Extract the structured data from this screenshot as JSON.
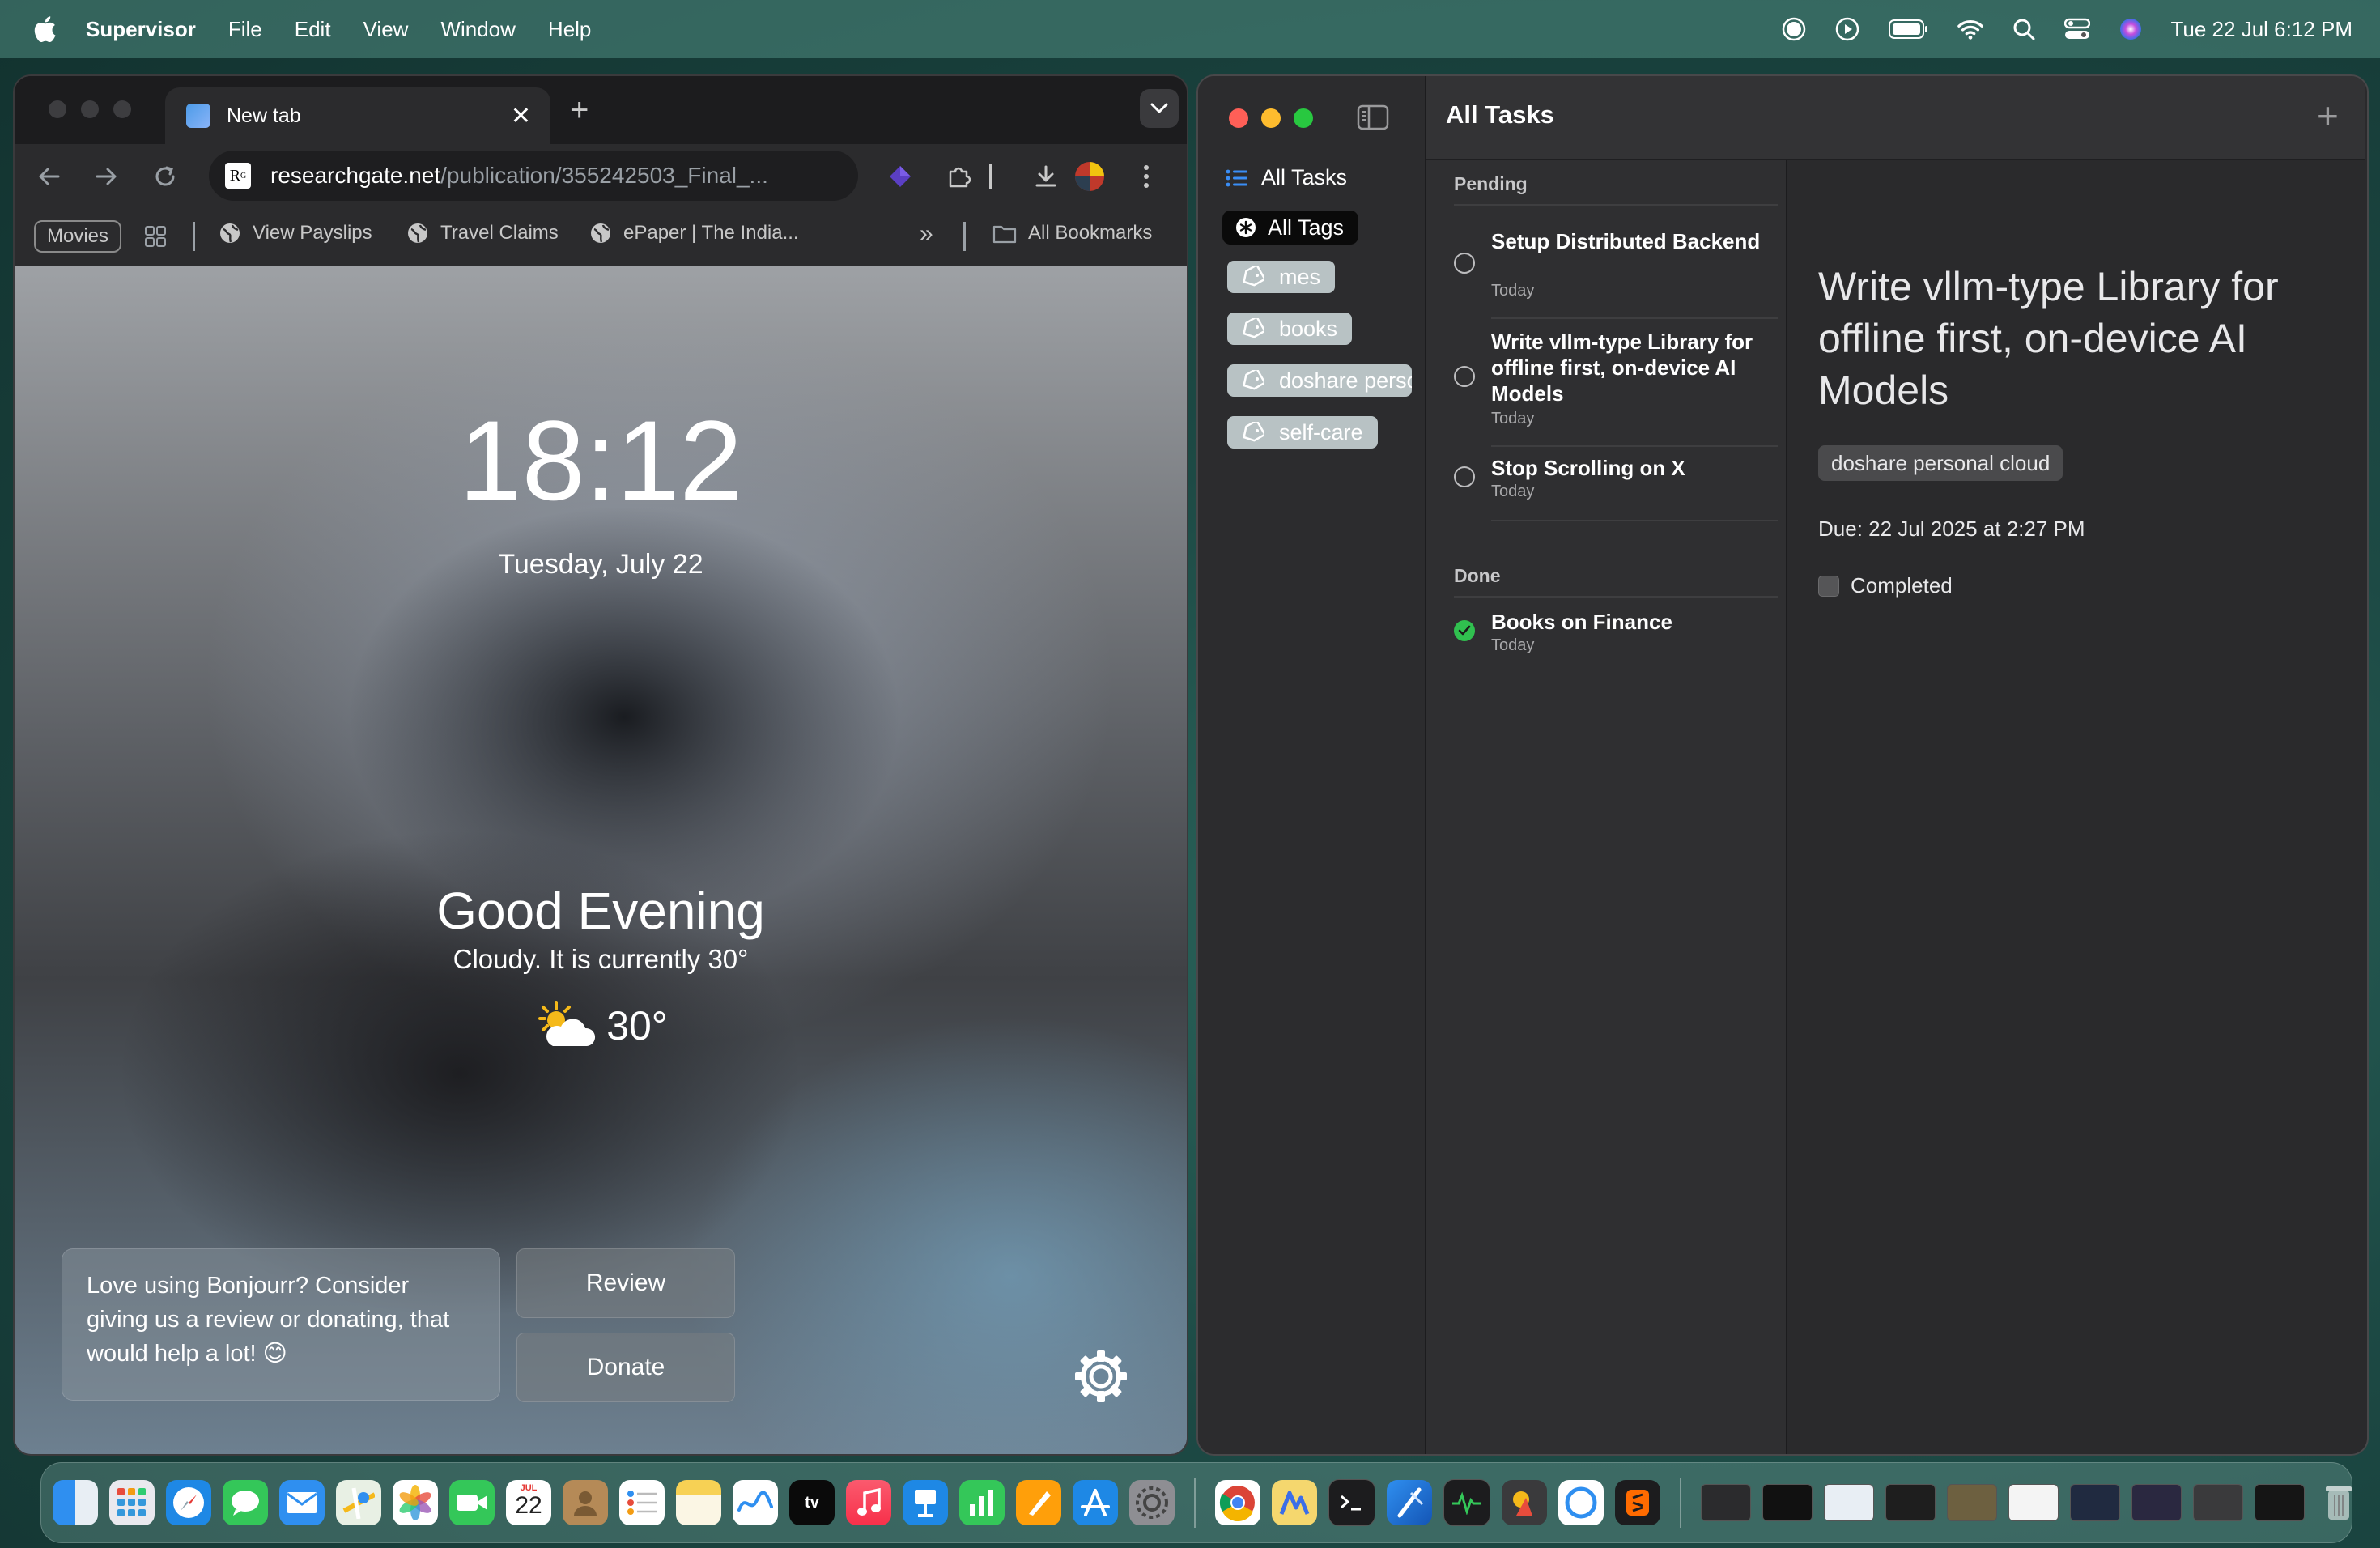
{
  "menubar": {
    "app_name": "Supervisor",
    "menus": [
      "File",
      "Edit",
      "View",
      "Window",
      "Help"
    ],
    "clock": "Tue 22 Jul  6:12 PM",
    "status_icons": [
      "record-icon",
      "play-icon",
      "battery-icon",
      "wifi-icon",
      "search-icon",
      "control-center-icon",
      "siri-icon"
    ]
  },
  "browser": {
    "tab": {
      "title": "New tab",
      "close": "✕"
    },
    "new_tab": "+",
    "address": {
      "host": "researchgate.net",
      "path": "/publication/355242503_Final_..."
    },
    "bookmarks": {
      "movies": "Movies",
      "items": [
        "View Payslips",
        "Travel Claims",
        "ePaper | The India..."
      ],
      "overflow": "»",
      "all": "All Bookmarks"
    },
    "page": {
      "time": "18:12",
      "date": "Tuesday, July 22",
      "greeting": "Good Evening",
      "weather_desc": "Cloudy. It is currently 30°",
      "temperature": "30°",
      "review_message": "Love using Bonjourr? Consider giving us a review or donating, that would help a lot! 😊",
      "review_button": "Review",
      "donate_button": "Donate"
    }
  },
  "supervisor": {
    "sidebar": {
      "all_tasks": "All Tasks",
      "all_tags": "All Tags",
      "tags": [
        "mes",
        "books",
        "doshare personal cloud",
        "self-care"
      ]
    },
    "header": {
      "title": "All Tasks",
      "add": "+"
    },
    "sections": {
      "pending": "Pending",
      "done": "Done"
    },
    "pending_tasks": [
      {
        "title": "Setup Distributed Backend",
        "when": "Today"
      },
      {
        "title": "Write vllm-type Library for offline first, on-device AI Models",
        "when": "Today"
      },
      {
        "title": "Stop Scrolling on X",
        "when": "Today"
      }
    ],
    "done_tasks": [
      {
        "title": "Books on Finance",
        "when": "Today"
      }
    ],
    "detail": {
      "title": "Write vllm-type Library for offline first, on-device AI Models",
      "tag": "doshare personal cloud",
      "due": "Due: 22 Jul 2025 at 2:27 PM",
      "completed_label": "Completed",
      "completed": false
    }
  },
  "dock": {
    "calendar_month": "JUL",
    "calendar_day": "22",
    "tv_label": "tv"
  },
  "colors": {
    "close": "#ff5f57",
    "minimize": "#febc2e",
    "zoom": "#28c840",
    "done_check": "#30c04f",
    "tag_pill": "#b8c2c4"
  }
}
